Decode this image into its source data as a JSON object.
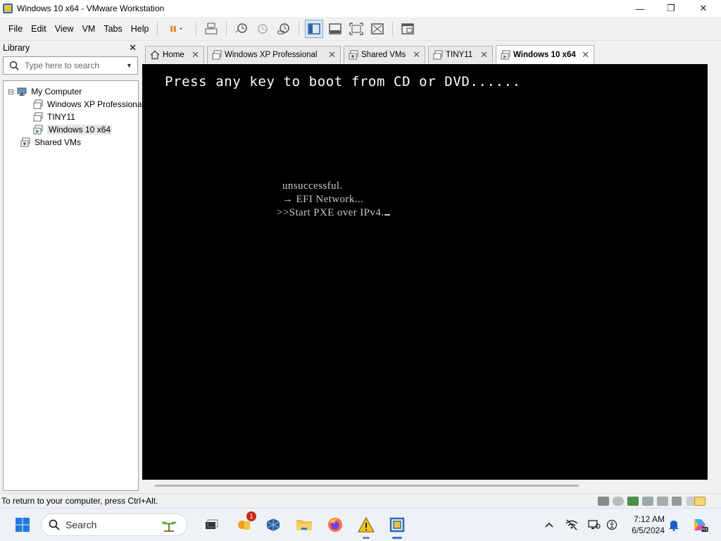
{
  "window": {
    "title": "Windows 10 x64 - VMware Workstation",
    "minimize": "—",
    "maximize": "❐",
    "close": "✕"
  },
  "menu": [
    "File",
    "Edit",
    "View",
    "VM",
    "Tabs",
    "Help"
  ],
  "toolbar": {
    "icons": [
      "pause-icon",
      "send-ctrl-alt-del-icon",
      "snapshot-icon",
      "revert-snapshot-icon",
      "snapshot-manager-icon",
      "library-view-icon",
      "thumbnail-bar-icon",
      "full-screen-icon",
      "unity-icon",
      "console-view-icon"
    ]
  },
  "library": {
    "title": "Library",
    "close": "✕",
    "search_placeholder": "Type here to search",
    "tree": [
      {
        "label": "My Computer",
        "expander": "⊟",
        "icon": "computer-icon"
      },
      {
        "label": "Windows XP Professional",
        "icon": "vm-icon"
      },
      {
        "label": "TINY11",
        "icon": "vm-icon"
      },
      {
        "label": "Windows 10 x64",
        "icon": "vm-running-icon",
        "selected": true
      },
      {
        "label": "Shared VMs",
        "icon": "shared-vms-icon"
      }
    ]
  },
  "tabs": [
    {
      "label": "Home",
      "icon": "home-icon",
      "close": "✕"
    },
    {
      "label": "Windows XP Professional",
      "icon": "vm-icon",
      "close": "✕"
    },
    {
      "label": "Shared VMs",
      "icon": "shared-vms-icon",
      "close": "✕"
    },
    {
      "label": "TINY11",
      "icon": "vm-icon",
      "close": "✕"
    },
    {
      "label": "Windows 10 x64",
      "icon": "vm-running-icon",
      "close": "✕",
      "active": true
    }
  ],
  "vm_console": {
    "boot_prompt": "Press any key to boot from CD or DVD......",
    "efi_lines": [
      "unsuccessful.",
      "→ EFI Network...",
      ">>Start PXE over IPv4."
    ]
  },
  "statusbar": {
    "message": "To return to your computer, press Ctrl+Alt.",
    "device_icons": [
      "hard-disk-icon",
      "cd-dvd-icon",
      "network-adapter-icon",
      "usb-icon",
      "printer-icon",
      "sound-card-icon",
      "display-icon",
      "message-log-icon"
    ]
  },
  "taskbar": {
    "search_label": "Search",
    "apps": [
      "start-icon",
      "task-view-icon",
      "notification-app-icon",
      "virtualbox-icon",
      "file-explorer-icon",
      "firefox-icon",
      "warning-app-icon",
      "vmware-icon"
    ],
    "badge_count": "1",
    "tray": [
      "chevron-up-icon",
      "network-off-icon",
      "display-settings-icon",
      "accessibility-icon",
      "bell-icon",
      "copilot-icon"
    ],
    "time": "7:12 AM",
    "date": "6/5/2024"
  },
  "colors": {
    "accent": "#2b6cb0",
    "vm_background": "#000000",
    "console_text": "#ffffff",
    "efi_text": "#c8c8c8",
    "taskbar_background": "#eef1f6"
  }
}
